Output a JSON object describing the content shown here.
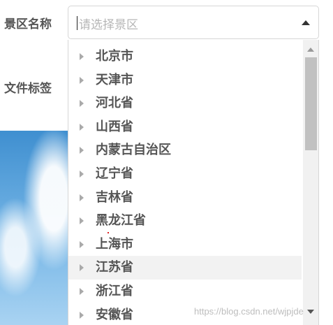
{
  "form": {
    "scenic_area_label": "景区名称",
    "file_tags_label": "文件标签"
  },
  "select": {
    "placeholder": "请选择景区",
    "options": [
      {
        "label": "北京市"
      },
      {
        "label": "天津市"
      },
      {
        "label": "河北省"
      },
      {
        "label": "山西省"
      },
      {
        "label": "内蒙古自治区"
      },
      {
        "label": "辽宁省"
      },
      {
        "label": "吉林省"
      },
      {
        "label": "黑龙江省"
      },
      {
        "label": "上海市"
      },
      {
        "label": "江苏省"
      },
      {
        "label": "浙江省"
      },
      {
        "label": "安徽省"
      }
    ],
    "highlighted_option": "江苏省"
  },
  "watermark": "https://blog.csdn.net/wjpjde",
  "colors": {
    "label_text": "#555555",
    "placeholder": "#b6b6b6",
    "highlight": "#f2f2f2",
    "scroll_thumb": "#c1c1c1"
  },
  "icons": [
    "chevron-up-icon",
    "caret-right-icon",
    "scroll-up-icon",
    "scroll-down-icon"
  ]
}
